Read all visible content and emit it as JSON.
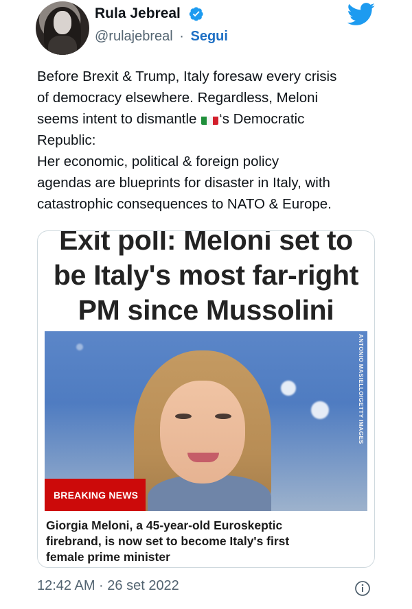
{
  "author": {
    "name": "Rula Jebreal",
    "handle": "@rulajebreal",
    "separator": "·",
    "follow_label": "Segui",
    "verified_icon": "verified-badge-icon",
    "avatar_icon": "profile-avatar"
  },
  "brand_icon": "twitter-bird-icon",
  "tweet": {
    "lines": [
      "Before Brexit & Trump, Italy foresaw every crisis",
      "of democracy elsewhere. Regardless, Meloni",
      "seems intent to dismantle",
      "Republic:",
      "Her economic, political & foreign policy",
      "agendas are blueprints for disaster in Italy, with",
      "catastrophic consequences to NATO & Europe."
    ],
    "line3_suffix": "‘s Democratic",
    "flag": "italy-flag-emoji"
  },
  "card": {
    "headline": [
      "Exit poll: Meloni set to",
      "be Italy's most far-right",
      "PM since Mussolini"
    ],
    "photo_credit": "ANTONIO MASIELLO/GETTY IMAGES",
    "badge": "BREAKING NEWS",
    "caption": [
      "Giorgia Meloni, a 45-year-old Euroskeptic",
      "firebrand, is now set to become Italy's first",
      "female prime minister"
    ]
  },
  "meta": {
    "timestamp": "12:42 AM · 26 set 2022",
    "info_icon": "info-icon"
  },
  "colors": {
    "accent": "#1d9bf0",
    "follow": "#1d6fc4",
    "muted": "#536471",
    "breaking_red": "#cc0a0a"
  }
}
